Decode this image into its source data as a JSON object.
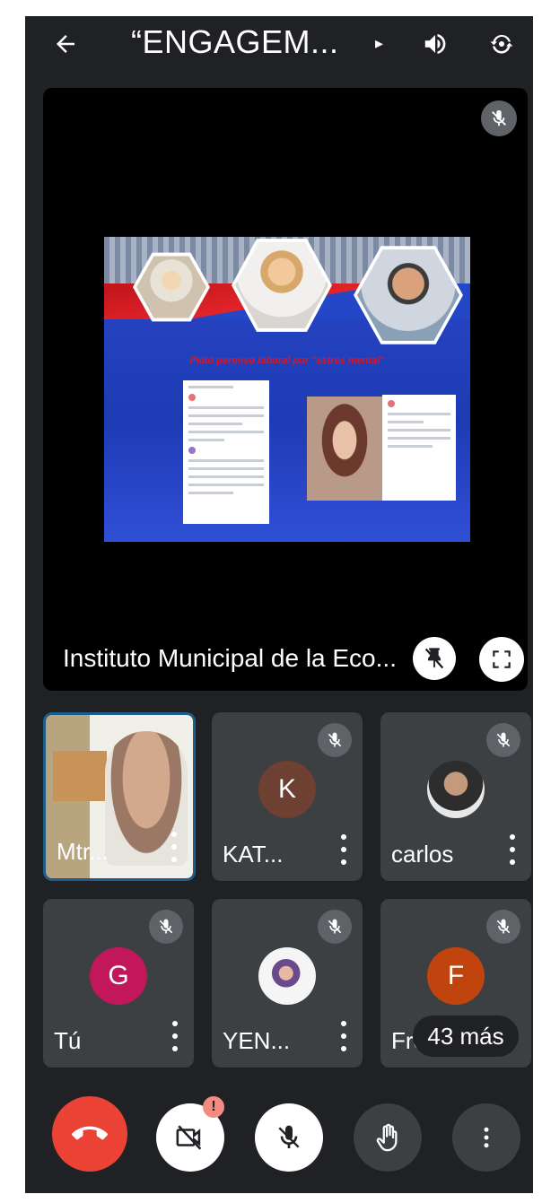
{
  "header": {
    "meeting_title": "“ENGAGEM...",
    "back_icon": "arrow-left-icon",
    "speaker_icon": "speaker-icon",
    "switch_camera_icon": "switch-camera-icon"
  },
  "presentation": {
    "presenter_name": "Instituto Municipal de la Eco...",
    "slide_heading": "Pidió permiso laboral por \"estrés mental\""
  },
  "participants": [
    {
      "name": "Mtr...",
      "type": "video"
    },
    {
      "name": "KAT...",
      "initial": "K",
      "avatar_color": "#6d4032",
      "muted": true
    },
    {
      "name": "carlos",
      "type": "photo",
      "muted": true
    },
    {
      "name": "Tú",
      "initial": "G",
      "avatar_color": "#c2185b",
      "muted": true
    },
    {
      "name": "YEN...",
      "type": "photo",
      "muted": true
    },
    {
      "name": "Fre",
      "initial": "F",
      "avatar_color": "#c1440e",
      "muted": true
    }
  ],
  "more_participants_label": "43 más",
  "controls": {
    "camera_alert": "!"
  },
  "colors": {
    "background": "#202124",
    "tile": "#3c4043",
    "end_call": "#ea4335",
    "active_border": "#1d5d8a"
  }
}
